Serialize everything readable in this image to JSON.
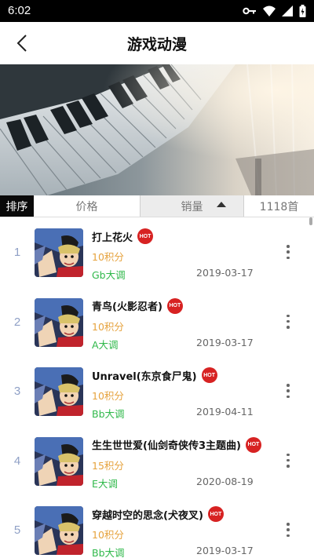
{
  "status_bar": {
    "time": "6:02",
    "icons": [
      "key-icon",
      "wifi-icon",
      "signal-icon",
      "battery-icon"
    ]
  },
  "header": {
    "title": "游戏动漫",
    "back_icon": "chevron-left-icon"
  },
  "sort_bar": {
    "label": "排序",
    "price": "价格",
    "sales": "销量",
    "count": "1118首"
  },
  "colors": {
    "index": "#8fa0c6",
    "price": "#e6a23c",
    "key": "#2fb84a",
    "hot": "#d72222"
  },
  "songs": [
    {
      "index": "1",
      "title": "打上花火",
      "badge": "HOT",
      "price": "10积分",
      "key": "Gb大调",
      "date": "2019-03-17"
    },
    {
      "index": "2",
      "title": "青鸟(火影忍者)",
      "badge": "HOT",
      "price": "10积分",
      "key": "A大调",
      "date": "2019-03-17"
    },
    {
      "index": "3",
      "title": "Unravel(东京食尸鬼)",
      "badge": "HOT",
      "price": "10积分",
      "key": "Bb大调",
      "date": "2019-04-11"
    },
    {
      "index": "4",
      "title": "生生世世爱(仙剑奇侠传3主题曲)",
      "badge": "HOT",
      "price": "15积分",
      "key": "E大调",
      "date": "2020-08-19"
    },
    {
      "index": "5",
      "title": "穿越时空的思念(犬夜叉)",
      "badge": "HOT",
      "price": "10积分",
      "key": "Bb大调",
      "date": "2019-03-17"
    }
  ]
}
